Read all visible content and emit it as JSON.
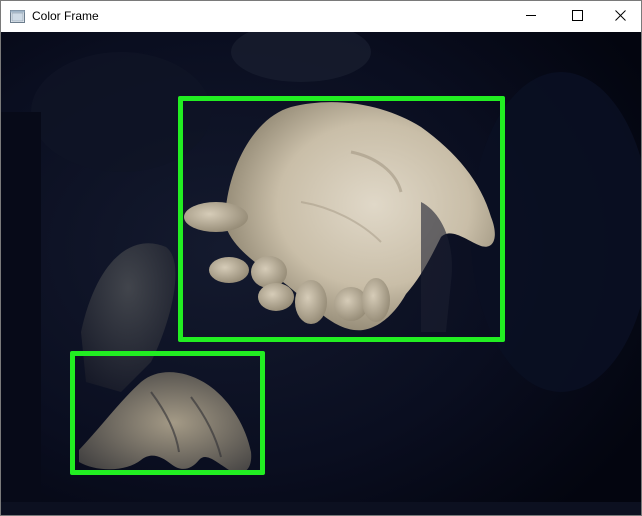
{
  "window": {
    "title": "Color Frame",
    "icon": "window-app-icon",
    "controls": [
      "minimize-icon",
      "maximize-icon",
      "close-icon"
    ]
  },
  "viewer": {
    "detection_box_color": "#22ee22",
    "background_color": "#05081a",
    "detections_count": 2
  }
}
